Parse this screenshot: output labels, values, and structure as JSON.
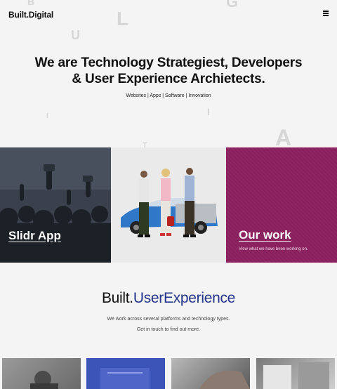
{
  "header": {
    "logo": "Built.Digital"
  },
  "hero": {
    "title_line1": "We are Technology  Strategiest, Developers",
    "title_line2": "& User Experience Archietects.",
    "tags": "Websites | Apps | Software | Innovation"
  },
  "bg_letters": [
    "B",
    "U",
    "L",
    "G",
    "I",
    "T",
    "A",
    "I"
  ],
  "panels": {
    "left_title": "Slidr App",
    "right_title": "Our work",
    "right_sub": "View what we have been working on."
  },
  "section": {
    "title_part1": "Built.",
    "title_part2": "UserExperience",
    "line1": "We work across several platforms and technology types.",
    "line2": "Get in touch to find out more."
  },
  "colors": {
    "accent_blue": "#23358a",
    "work_panel": "#8a1f5e"
  }
}
